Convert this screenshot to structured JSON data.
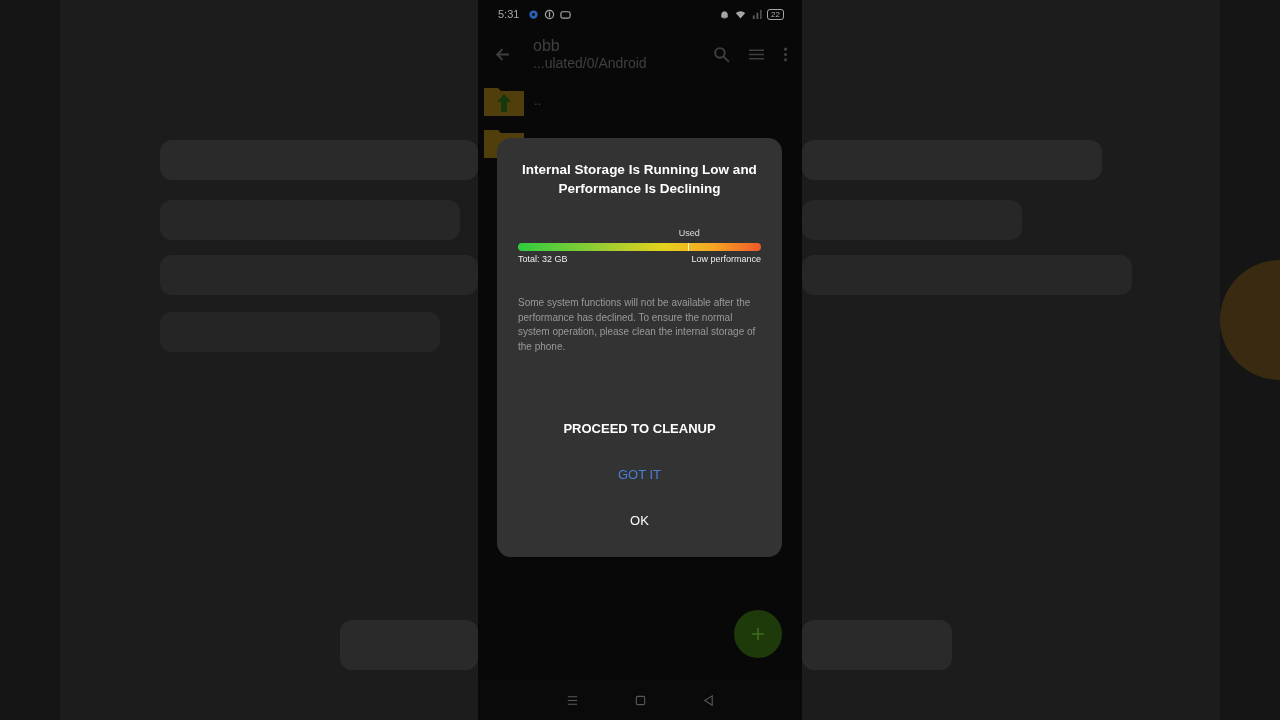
{
  "status_bar": {
    "time": "5:31",
    "battery": "22"
  },
  "toolbar": {
    "title": "obb",
    "path": "...ulated/0/Android"
  },
  "files": [
    {
      "name": ".."
    }
  ],
  "dialog": {
    "title": "Internal Storage Is Running Low and Performance Is Declining",
    "meter": {
      "marker_label": "Used",
      "level": 0.7,
      "left_label": "Total: 32 GB",
      "right_label": "Low performance"
    },
    "message": "Some system functions will not be available after the performance has declined. To ensure the normal system operation, please clean the internal storage of the phone.",
    "buttons": [
      {
        "label": "PROCEED TO CLEANUP",
        "kind": "primary"
      },
      {
        "label": "GOT IT",
        "kind": "accent"
      },
      {
        "label": "OK",
        "kind": "plain"
      }
    ]
  }
}
